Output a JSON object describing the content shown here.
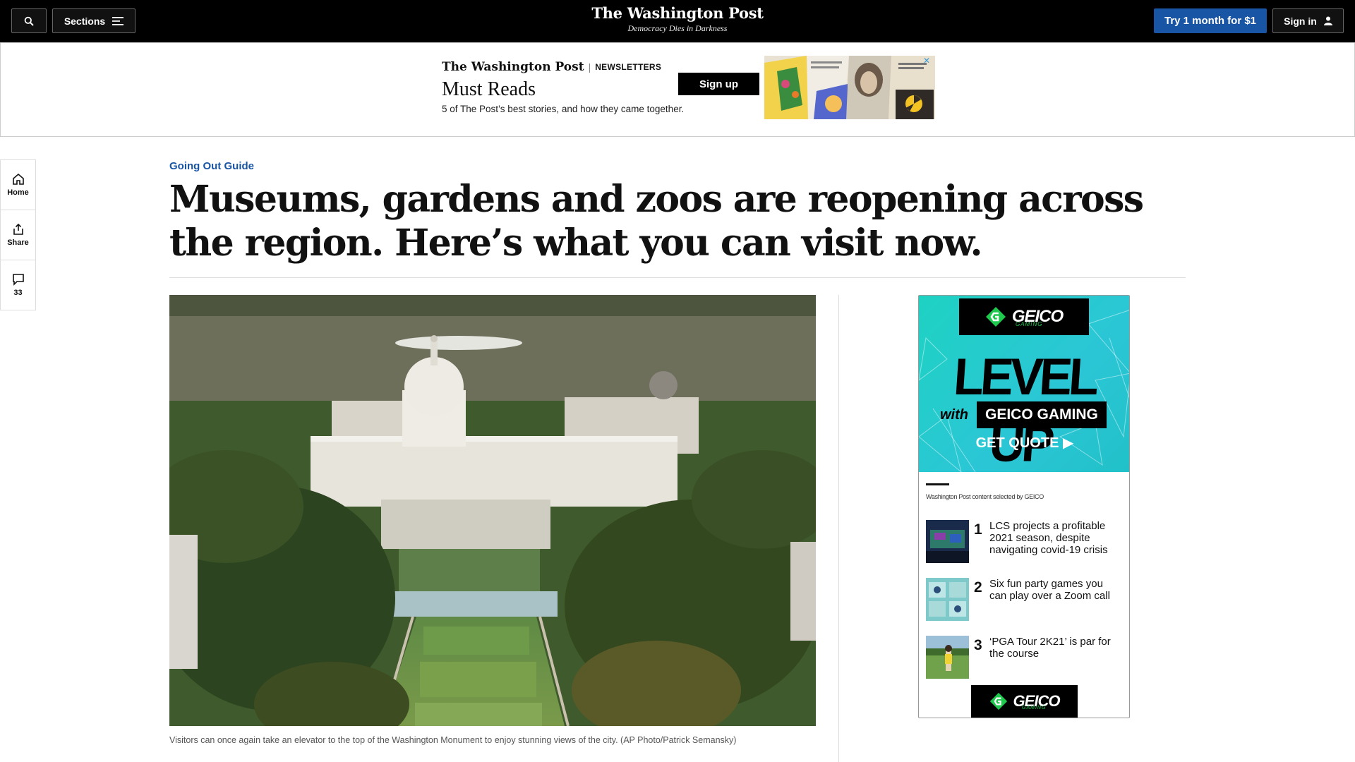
{
  "topbar": {
    "sections_label": "Sections",
    "logo_text": "The Washington Post",
    "tagline": "Democracy Dies in Darkness",
    "subscribe_label": "Try 1 month for $1",
    "signin_label": "Sign in"
  },
  "newsletter_ad": {
    "brand": "The Washington Post",
    "divider": "|",
    "category": "NEWSLETTERS",
    "title": "Must Reads",
    "description": "5 of The Post’s best stories, and how they came together.",
    "signup_label": "Sign up",
    "close_glyph": "✕"
  },
  "rail": {
    "home_label": "Home",
    "share_label": "Share",
    "comment_count": "33"
  },
  "article": {
    "kicker": "Going Out Guide",
    "headline": "Museums, gardens and zoos are reopening across the region. Here’s what you can visit now.",
    "caption": "Visitors can once again take an elevator to the top of the Washington Monument to enjoy stunning views of the city. (AP Photo/Patrick Semansky)"
  },
  "geico_ad": {
    "logo_word": "GEICO",
    "logo_sub": "GAMING",
    "headline": "LEVEL UP",
    "with": "with",
    "brand_line": "GEICO GAMING",
    "cta": "GET QUOTE ▶",
    "selected_note": "Washington Post content selected by GEICO",
    "items": [
      {
        "num": "1",
        "text": "LCS projects a profitable 2021 season, despite navigating covid-19 crisis"
      },
      {
        "num": "2",
        "text": "Six fun party games you can play over a Zoom call"
      },
      {
        "num": "3",
        "text": "‘PGA Tour 2K21’ is par for the course"
      }
    ],
    "accent_green": "#1ec94e",
    "accent_teal": "#2bc6d6"
  },
  "colors": {
    "link_blue": "#1955a5",
    "topbar_bg": "#000000"
  }
}
